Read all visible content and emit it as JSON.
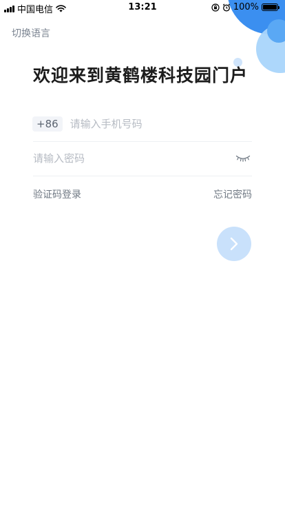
{
  "status_bar": {
    "carrier": "中国电信",
    "time": "13:21",
    "battery_percent": "100%",
    "battery_level": 1.0
  },
  "header": {
    "language_switch": "切换语言"
  },
  "main": {
    "welcome_title": "欢迎来到黄鹤楼科技园门户",
    "phone": {
      "country_code": "+86",
      "placeholder": "请输入手机号码",
      "value": ""
    },
    "password": {
      "placeholder": "请输入密码",
      "value": "",
      "visibility_icon": "eye-closed-icon"
    },
    "links": {
      "sms_login": "验证码登录",
      "forgot_password": "忘记密码"
    },
    "next_button_icon": "chevron-right-icon"
  },
  "colors": {
    "accent": "#3b8ff0",
    "accent_light": "#a9d5fb",
    "next_button_bg": "#c9e1fb"
  }
}
